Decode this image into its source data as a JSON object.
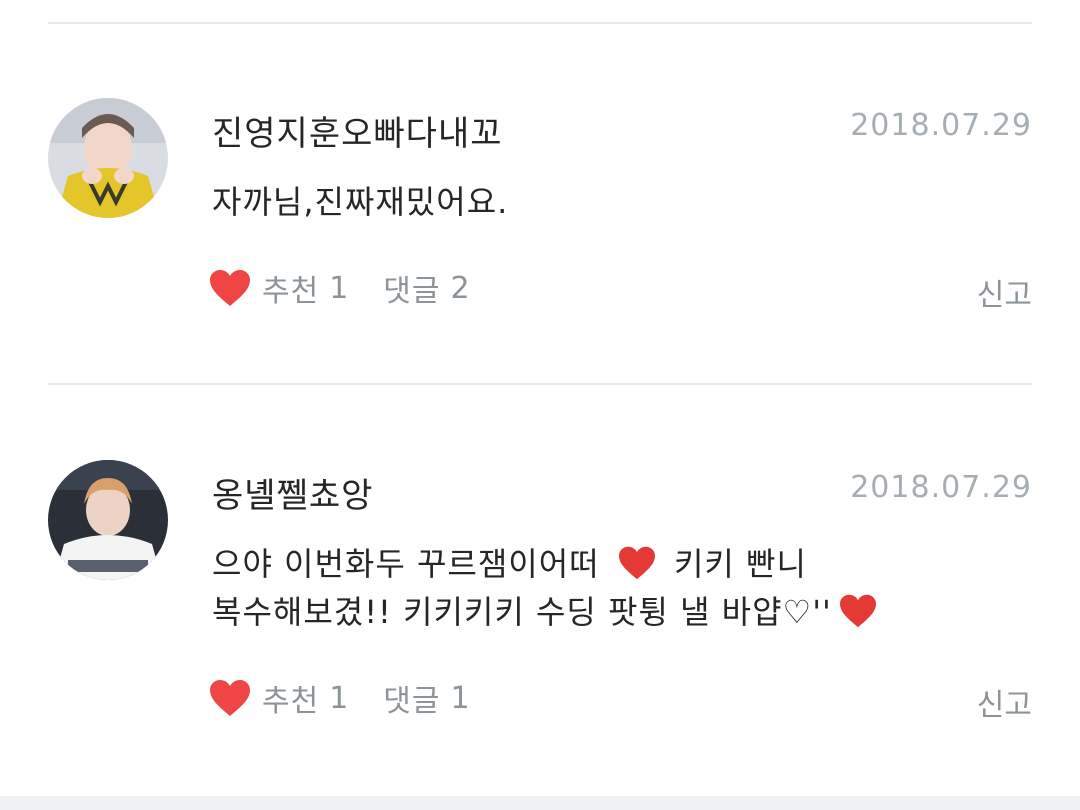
{
  "comments": [
    {
      "username": "진영지훈오빠다내꼬",
      "date": "2018.07.29",
      "body": "자까님,진짜재밌어요.",
      "recommend_label": "추천",
      "recommend_count": "1",
      "reply_label": "댓글",
      "reply_count": "2",
      "report_label": "신고",
      "avatar_colors": {
        "bg": "#d9dde3",
        "shirt": "#e4c52a",
        "skin": "#f2d7c8"
      }
    },
    {
      "username": "옹녤쩰쵸앙",
      "date": "2018.07.29",
      "body_line1_a": "으야 이번화두 꾸르잼이어떠",
      "body_line1_b": "키키 빤니",
      "body_line2_a": "복수해보겼!! 키키키키 수딩 팟튕 낼 바얍♡''",
      "recommend_label": "추천",
      "recommend_count": "1",
      "reply_label": "댓글",
      "reply_count": "1",
      "report_label": "신고",
      "avatar_colors": {
        "bg": "#2a2f38",
        "shirt": "#f4f4f4",
        "skin": "#edd3c4"
      }
    }
  ],
  "colors": {
    "heart": "#ef4545",
    "heart_inline": "#e53935",
    "divider": "#e6e8ea",
    "muted": "#8d9499",
    "date": "#a7aeb3"
  }
}
